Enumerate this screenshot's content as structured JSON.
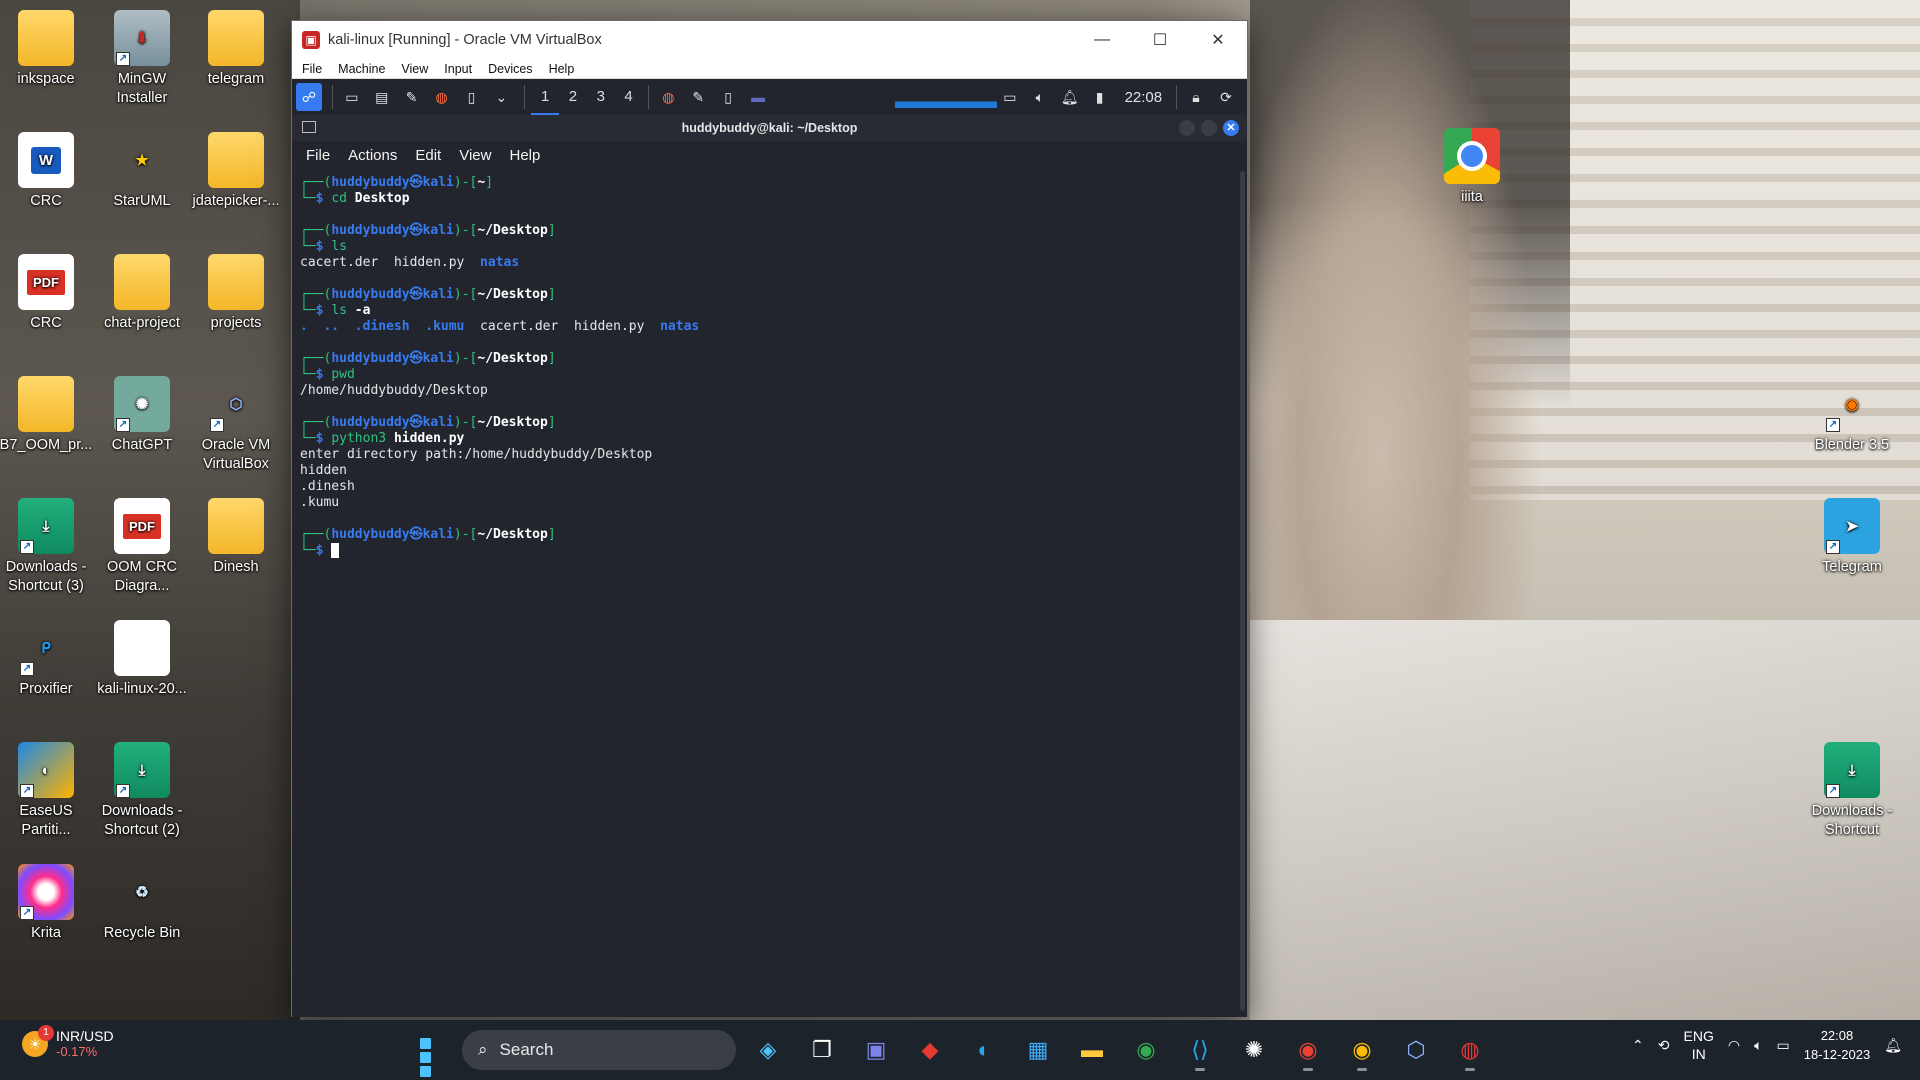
{
  "desktop_icons": [
    {
      "label": "inkspace"
    },
    {
      "label": "MinGW Installer"
    },
    {
      "label": "telegram"
    },
    {
      "label": "CRC"
    },
    {
      "label": "StarUML"
    },
    {
      "label": "jdatepicker-..."
    },
    {
      "label": "CRC"
    },
    {
      "label": "chat-project"
    },
    {
      "label": "projects"
    },
    {
      "label": "B7_OOM_pr..."
    },
    {
      "label": "ChatGPT"
    },
    {
      "label": "Oracle VM VirtualBox"
    },
    {
      "label": "Downloads - Shortcut (3)"
    },
    {
      "label": "OOM CRC Diagra..."
    },
    {
      "label": "Dinesh"
    },
    {
      "label": "Proxifier"
    },
    {
      "label": "kali-linux-20..."
    },
    {
      "label": "EaseUS Partiti..."
    },
    {
      "label": "Downloads - Shortcut (2)"
    },
    {
      "label": "Krita"
    },
    {
      "label": "Recycle Bin"
    },
    {
      "label": "iiita"
    },
    {
      "label": "Blender 3.5"
    },
    {
      "label": "Telegram"
    },
    {
      "label": "Downloads - Shortcut"
    }
  ],
  "icon_badges": {
    "word": "W",
    "pdf": "PDF"
  },
  "vbox": {
    "title": "kali-linux [Running] - Oracle VM VirtualBox",
    "menu": [
      "File",
      "Machine",
      "View",
      "Input",
      "Devices",
      "Help"
    ]
  },
  "kali_panel": {
    "workspaces": [
      "1",
      "2",
      "3",
      "4"
    ],
    "active_workspace": "1",
    "clock": "22:08"
  },
  "terminal": {
    "title": "huddybuddy@kali: ~/Desktop",
    "menu": [
      "File",
      "Actions",
      "Edit",
      "View",
      "Help"
    ],
    "user": "huddybuddy",
    "host": "kali",
    "blocks": [
      {
        "dir": "~",
        "cmd_name": "cd",
        "cmd_arg": "Desktop",
        "output": []
      },
      {
        "dir": "~/Desktop",
        "cmd_name": "ls",
        "cmd_arg": "",
        "output": [
          "cacert.der  hidden.py  natas"
        ]
      },
      {
        "dir": "~/Desktop",
        "cmd_name": "ls",
        "cmd_arg": "-a",
        "output": [
          ".  ..  .dinesh  .kumu  cacert.der  hidden.py  natas"
        ]
      },
      {
        "dir": "~/Desktop",
        "cmd_name": "pwd",
        "cmd_arg": "",
        "output": [
          "/home/huddybuddy/Desktop"
        ]
      },
      {
        "dir": "~/Desktop",
        "cmd_name": "python3",
        "cmd_arg": "hidden.py",
        "output": [
          "enter directory path:/home/huddybuddy/Desktop",
          "hidden",
          ".dinesh",
          ".kumu"
        ]
      },
      {
        "dir": "~/Desktop",
        "cmd_name": "",
        "cmd_arg": "",
        "output": []
      }
    ]
  },
  "taskbar": {
    "widget_title": "INR/USD",
    "widget_value": "-0.17%",
    "widget_badge": "1",
    "search_placeholder": "Search",
    "lang_line1": "ENG",
    "lang_line2": "IN",
    "time": "22:08",
    "date": "18-12-2023"
  },
  "colors": {
    "accent": "#367bf0",
    "prompt_green": "#2ec27e",
    "terminal_bg": "#23252e"
  }
}
